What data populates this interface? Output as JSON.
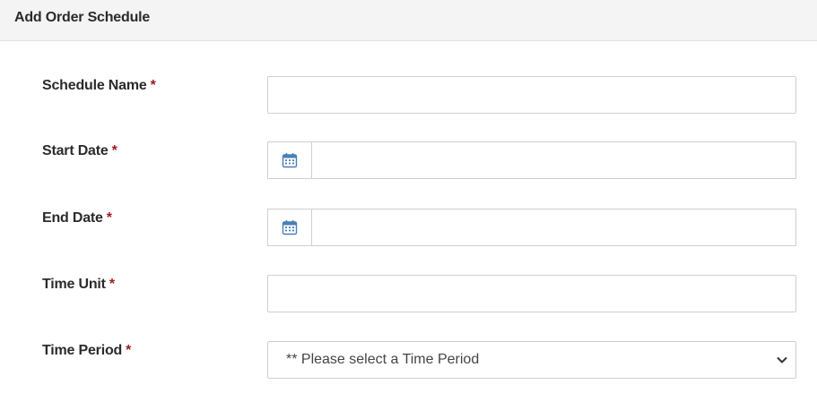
{
  "header": {
    "title": "Add Order Schedule"
  },
  "form": {
    "required_marker": "*",
    "schedule_name": {
      "label": "Schedule Name",
      "value": ""
    },
    "start_date": {
      "label": "Start Date",
      "value": "",
      "icon": "calendar-icon"
    },
    "end_date": {
      "label": "End Date",
      "value": "",
      "icon": "calendar-icon"
    },
    "time_unit": {
      "label": "Time Unit",
      "value": ""
    },
    "time_period": {
      "label": "Time Period",
      "selected": "** Please select a Time Period"
    }
  },
  "colors": {
    "required": "#9b1c1c",
    "calendar_icon": "#4a7fb5"
  }
}
